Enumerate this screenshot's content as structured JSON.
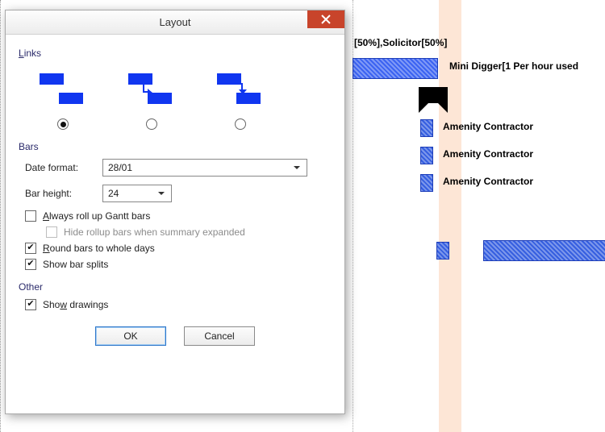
{
  "dialog": {
    "title": "Layout",
    "sections": {
      "links": {
        "label": "Links",
        "selected_index": 0
      },
      "bars": {
        "label": "Bars"
      },
      "other": {
        "label": "Other"
      }
    },
    "date_format_label": "Date format:",
    "date_format_value": "28/01",
    "bar_height_label": "Bar height:",
    "bar_height_value": "24",
    "checkboxes": {
      "always_roll": {
        "label": "Always roll up Gantt bars",
        "checked": false,
        "underline": "A"
      },
      "hide_rollup": {
        "label": "Hide rollup bars when summary expanded",
        "checked": false,
        "enabled": false
      },
      "round_bars": {
        "label": "Round bars to whole days",
        "checked": true,
        "underline": "R"
      },
      "show_splits": {
        "label": "Show bar splits",
        "checked": true
      },
      "show_drawings": {
        "label": "Show drawings",
        "checked": true,
        "underline": "w"
      }
    },
    "buttons": {
      "ok": "OK",
      "cancel": "Cancel"
    }
  },
  "gantt": {
    "top_label": "[50%],Solicitor[50%]",
    "big_bar_label": "Mini Digger[1 Per hour used",
    "amenity_label": "Amenity Contractor"
  }
}
